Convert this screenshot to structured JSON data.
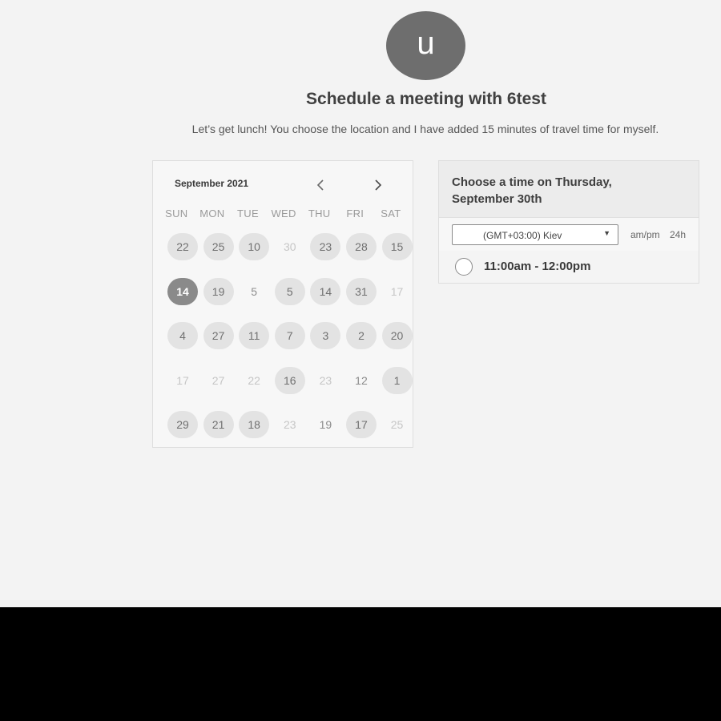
{
  "header": {
    "avatar_letter": "u",
    "title": "Schedule a meeting with 6test",
    "subtitle": "Let’s get lunch! You choose the location and I have added 15 minutes of travel time for myself."
  },
  "calendar": {
    "month": "September 2021",
    "prev_icon": "chevron-left-icon",
    "next_icon": "chevron-right-icon",
    "weekdays": [
      "SUN",
      "MON",
      "TUE",
      "WED",
      "THU",
      "FRI",
      "SAT"
    ],
    "days": [
      {
        "label": "22",
        "state": "avail"
      },
      {
        "label": "25",
        "state": "avail"
      },
      {
        "label": "10",
        "state": "avail"
      },
      {
        "label": "30",
        "state": "disabled"
      },
      {
        "label": "23",
        "state": "avail"
      },
      {
        "label": "28",
        "state": "avail"
      },
      {
        "label": "15",
        "state": "avail"
      },
      {
        "label": "14",
        "state": "selected"
      },
      {
        "label": "19",
        "state": "avail"
      },
      {
        "label": "5",
        "state": "plain"
      },
      {
        "label": "5",
        "state": "avail"
      },
      {
        "label": "14",
        "state": "avail"
      },
      {
        "label": "31",
        "state": "avail"
      },
      {
        "label": "17",
        "state": "disabled"
      },
      {
        "label": "4",
        "state": "avail"
      },
      {
        "label": "27",
        "state": "avail"
      },
      {
        "label": "11",
        "state": "avail"
      },
      {
        "label": "7",
        "state": "avail"
      },
      {
        "label": "3",
        "state": "avail"
      },
      {
        "label": "2",
        "state": "avail"
      },
      {
        "label": "20",
        "state": "avail"
      },
      {
        "label": "17",
        "state": "disabled"
      },
      {
        "label": "27",
        "state": "disabled"
      },
      {
        "label": "22",
        "state": "disabled"
      },
      {
        "label": "16",
        "state": "avail"
      },
      {
        "label": "23",
        "state": "disabled"
      },
      {
        "label": "12",
        "state": "plain"
      },
      {
        "label": "1",
        "state": "avail"
      },
      {
        "label": "29",
        "state": "avail"
      },
      {
        "label": "21",
        "state": "avail"
      },
      {
        "label": "18",
        "state": "avail"
      },
      {
        "label": "23",
        "state": "disabled"
      },
      {
        "label": "19",
        "state": "plain"
      },
      {
        "label": "17",
        "state": "avail"
      },
      {
        "label": "25",
        "state": "disabled"
      }
    ]
  },
  "time_panel": {
    "title": "Choose a time on Thursday, September 30th",
    "timezone": "(GMT+03:00) Kiev",
    "format_ampm": "am/pm",
    "format_24h": "24h",
    "slots": [
      "11:00am - 12:00pm"
    ]
  },
  "colors": {
    "background": "#f3f3f3",
    "avatar": "#6e6e6e",
    "available_day": "#e3e3e3",
    "selected_day": "#8a8a8a"
  }
}
